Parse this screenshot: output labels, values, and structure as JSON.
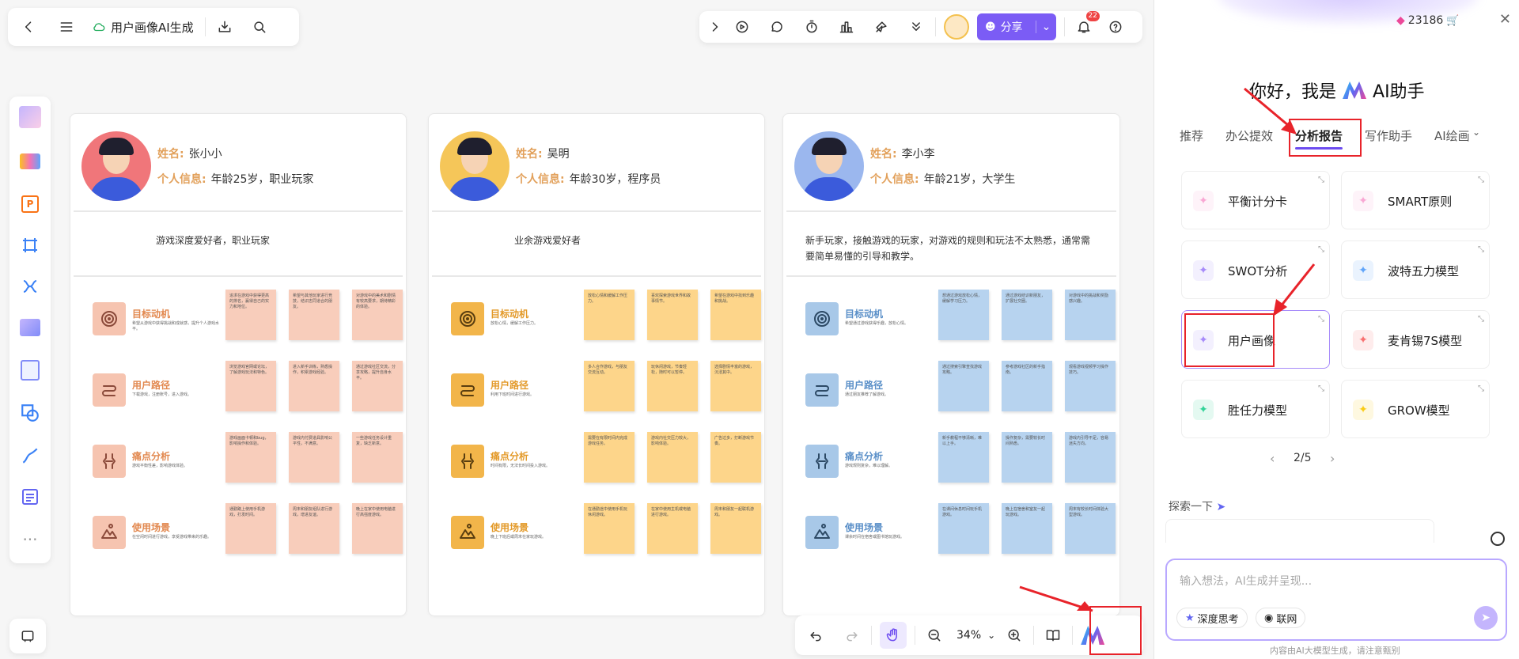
{
  "app": {
    "title": "用户画像AI生成"
  },
  "toolbar": {
    "share_label": "分享",
    "notification_count": "22"
  },
  "credits": "23186",
  "cards": [
    {
      "name_label": "姓名:",
      "name": "张小小",
      "info_label": "个人信息:",
      "info": "年龄25岁，职业玩家",
      "desc": "游戏深度爱好者，职业玩家",
      "accent": "#f8cdbb",
      "icon_bg": "#f6c4b0",
      "icon_color": "#8b4a3a",
      "title_color": "#e2884f",
      "avatar_bg": "#f0767a",
      "rows": [
        {
          "title": "目标动机",
          "sub": "希望从游戏中获得挑战和成就感，提升个人游戏水平。",
          "notes": [
            "追求在游戏中获得更高的排名，赢得自己的实力和地位。",
            "希望与其他玩家进行竞技，结识志同道合的朋友。",
            "对游戏中的美术和剧情有较高要求，期待精彩的体验。"
          ]
        },
        {
          "title": "用户路径",
          "sub": "下载游戏，注册账号，进入游戏。",
          "notes": [
            "浏览游戏官网或论坛，了解游戏玩法和特色。",
            "进入新手训练，熟悉操作，积累游戏经验。",
            "通过游戏社区交流，分享攻略，提升自身水平。"
          ]
        },
        {
          "title": "痛点分析",
          "sub": "游戏平衡性差，影响游戏体验。",
          "notes": [
            "游戏画面卡顿和bug，影响操作和体验。",
            "游戏内付费道具影响公平性，不满意。",
            "一些游戏任务设计重复，缺乏新意。"
          ]
        },
        {
          "title": "使用场景",
          "sub": "在空闲时间进行游戏，享受游戏带来的乐趣。",
          "notes": [
            "通勤路上使用手机游戏，打发时间。",
            "周末和朋友组队进行游戏，增进友谊。",
            "晚上在家中使用电脑进行高强度游戏。"
          ]
        }
      ]
    },
    {
      "name_label": "姓名:",
      "name": "吴明",
      "info_label": "个人信息:",
      "info": "年龄30岁，程序员",
      "desc": "业余游戏爱好者",
      "accent": "#fdd58a",
      "icon_bg": "#f2b54a",
      "icon_color": "#5a3e10",
      "title_color": "#e39a2a",
      "avatar_bg": "#f5c659",
      "rows": [
        {
          "title": "目标动机",
          "sub": "放松心情，缓解工作压力。",
          "notes": [
            "放松心情和缓解工作压力。",
            "喜欢探索游戏世界和故事情节。",
            "希望在游戏中找到乐趣和挑战。"
          ]
        },
        {
          "title": "用户路径",
          "sub": "利用下班时间进行游戏。",
          "notes": [
            "多人合作游戏，与朋友交流互动。",
            "玩休闲游戏，节奏轻松，随时可以暂停。",
            "选择剧情丰富的游戏，沉浸其中。"
          ]
        },
        {
          "title": "痛点分析",
          "sub": "时间有限，无法长时间投入游戏。",
          "notes": [
            "需要在有限时间内完成游戏任务。",
            "游戏内社交压力较大，影响体验。",
            "广告过多，打断游戏节奏。"
          ]
        },
        {
          "title": "使用场景",
          "sub": "晚上下班后或周末在家玩游戏。",
          "notes": [
            "在通勤途中使用手机玩休闲游戏。",
            "在家中使用主机或电脑进行游戏。",
            "周末和朋友一起联机游戏。"
          ]
        }
      ]
    },
    {
      "name_label": "姓名:",
      "name": "李小李",
      "info_label": "个人信息:",
      "info": "年龄21岁，大学生",
      "desc": "新手玩家，接触游戏的玩家，对游戏的规则和玩法不太熟悉，通常需要简单易懂的引导和教学。",
      "accent": "#b7d3ef",
      "icon_bg": "#a8c8e8",
      "icon_color": "#2d4a66",
      "title_color": "#5a8fc8",
      "avatar_bg": "#9bb7ee",
      "rows": [
        {
          "title": "目标动机",
          "sub": "希望通过游戏获得乐趣，放松心情。",
          "notes": [
            "想通过游戏放松心情，缓解学习压力。",
            "通过游戏结识新朋友，扩展社交圈。",
            "对游戏中的挑战和奖励感兴趣。"
          ]
        },
        {
          "title": "用户路径",
          "sub": "通过朋友推荐了解游戏。",
          "notes": [
            "通过搜索引擎查找游戏攻略。",
            "参考游戏社区的新手指南。",
            "观看游戏视频学习操作技巧。"
          ]
        },
        {
          "title": "痛点分析",
          "sub": "游戏规则复杂，难以理解。",
          "notes": [
            "新手教程不够清晰，难以上手。",
            "操作复杂，需要较长时间熟悉。",
            "游戏内引导不足，容易迷失方向。"
          ]
        },
        {
          "title": "使用场景",
          "sub": "课余时间在宿舍或图书馆玩游戏。",
          "notes": [
            "在课间休息时间玩手机游戏。",
            "晚上在宿舍和室友一起玩游戏。",
            "周末有较长时间体验大型游戏。"
          ]
        }
      ]
    }
  ],
  "zoom": {
    "value": "34%"
  },
  "panel": {
    "greeting_prefix": "你好，我是",
    "greeting_suffix": "AI助手",
    "tabs": [
      "推荐",
      "办公提效",
      "分析报告",
      "写作助手",
      "AI绘画"
    ],
    "active_tab_index": 2,
    "cards": [
      {
        "label": "平衡计分卡",
        "color": "#f9a8d4"
      },
      {
        "label": "SMART原则",
        "color": "#f9a8d4"
      },
      {
        "label": "SWOT分析",
        "color": "#a78bfa"
      },
      {
        "label": "波特五力模型",
        "color": "#60a5fa"
      },
      {
        "label": "用户画像",
        "color": "#a78bfa"
      },
      {
        "label": "麦肯锡7S模型",
        "color": "#f87171"
      },
      {
        "label": "胜任力模型",
        "color": "#34d399"
      },
      {
        "label": "GROW模型",
        "color": "#facc15"
      }
    ],
    "pager": "2/5",
    "explore_label": "探索一下",
    "input_placeholder": "输入想法，AI生成并呈现...",
    "deep_think_label": "深度思考",
    "web_label": "联网",
    "disclaimer": "内容由AI大模型生成，请注意甄别"
  }
}
